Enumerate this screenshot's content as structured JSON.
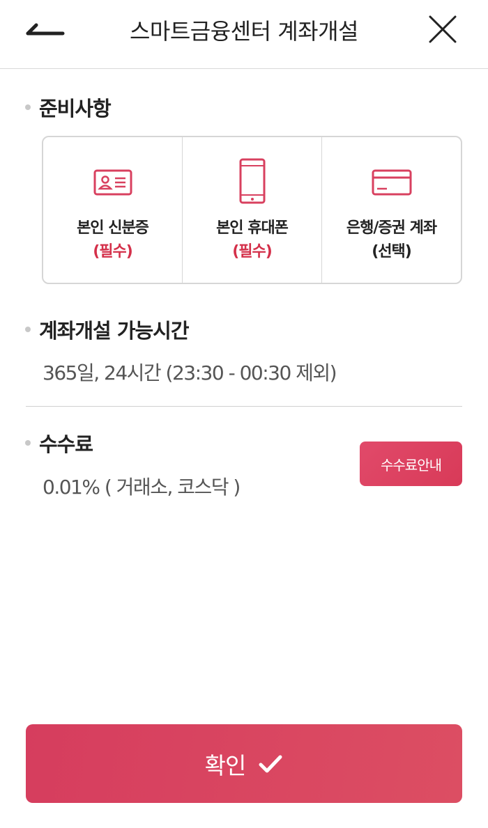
{
  "header": {
    "title": "스마트금융센터 계좌개설",
    "back_icon": "back-arrow-icon",
    "close_icon": "close-icon"
  },
  "preparation": {
    "title": "준비사항",
    "items": [
      {
        "label": "본인 신분증",
        "sub": "(필수)",
        "icon": "id-card-icon"
      },
      {
        "label": "본인 휴대폰",
        "sub": "(필수)",
        "icon": "mobile-phone-icon"
      },
      {
        "label": "은행/증권 계좌",
        "sub": "(선택)",
        "icon": "credit-card-icon"
      }
    ]
  },
  "hours": {
    "title": "계좌개설 가능시간",
    "text": "365일, 24시간 (23:30 - 00:30 제외)"
  },
  "fee": {
    "title": "수수료",
    "text": "0.01% ( 거래소, 코스닥 )",
    "guide_button": "수수료안내"
  },
  "confirm": {
    "label": "확인"
  },
  "colors": {
    "accent": "#d8405f",
    "required": "#d4304a"
  }
}
